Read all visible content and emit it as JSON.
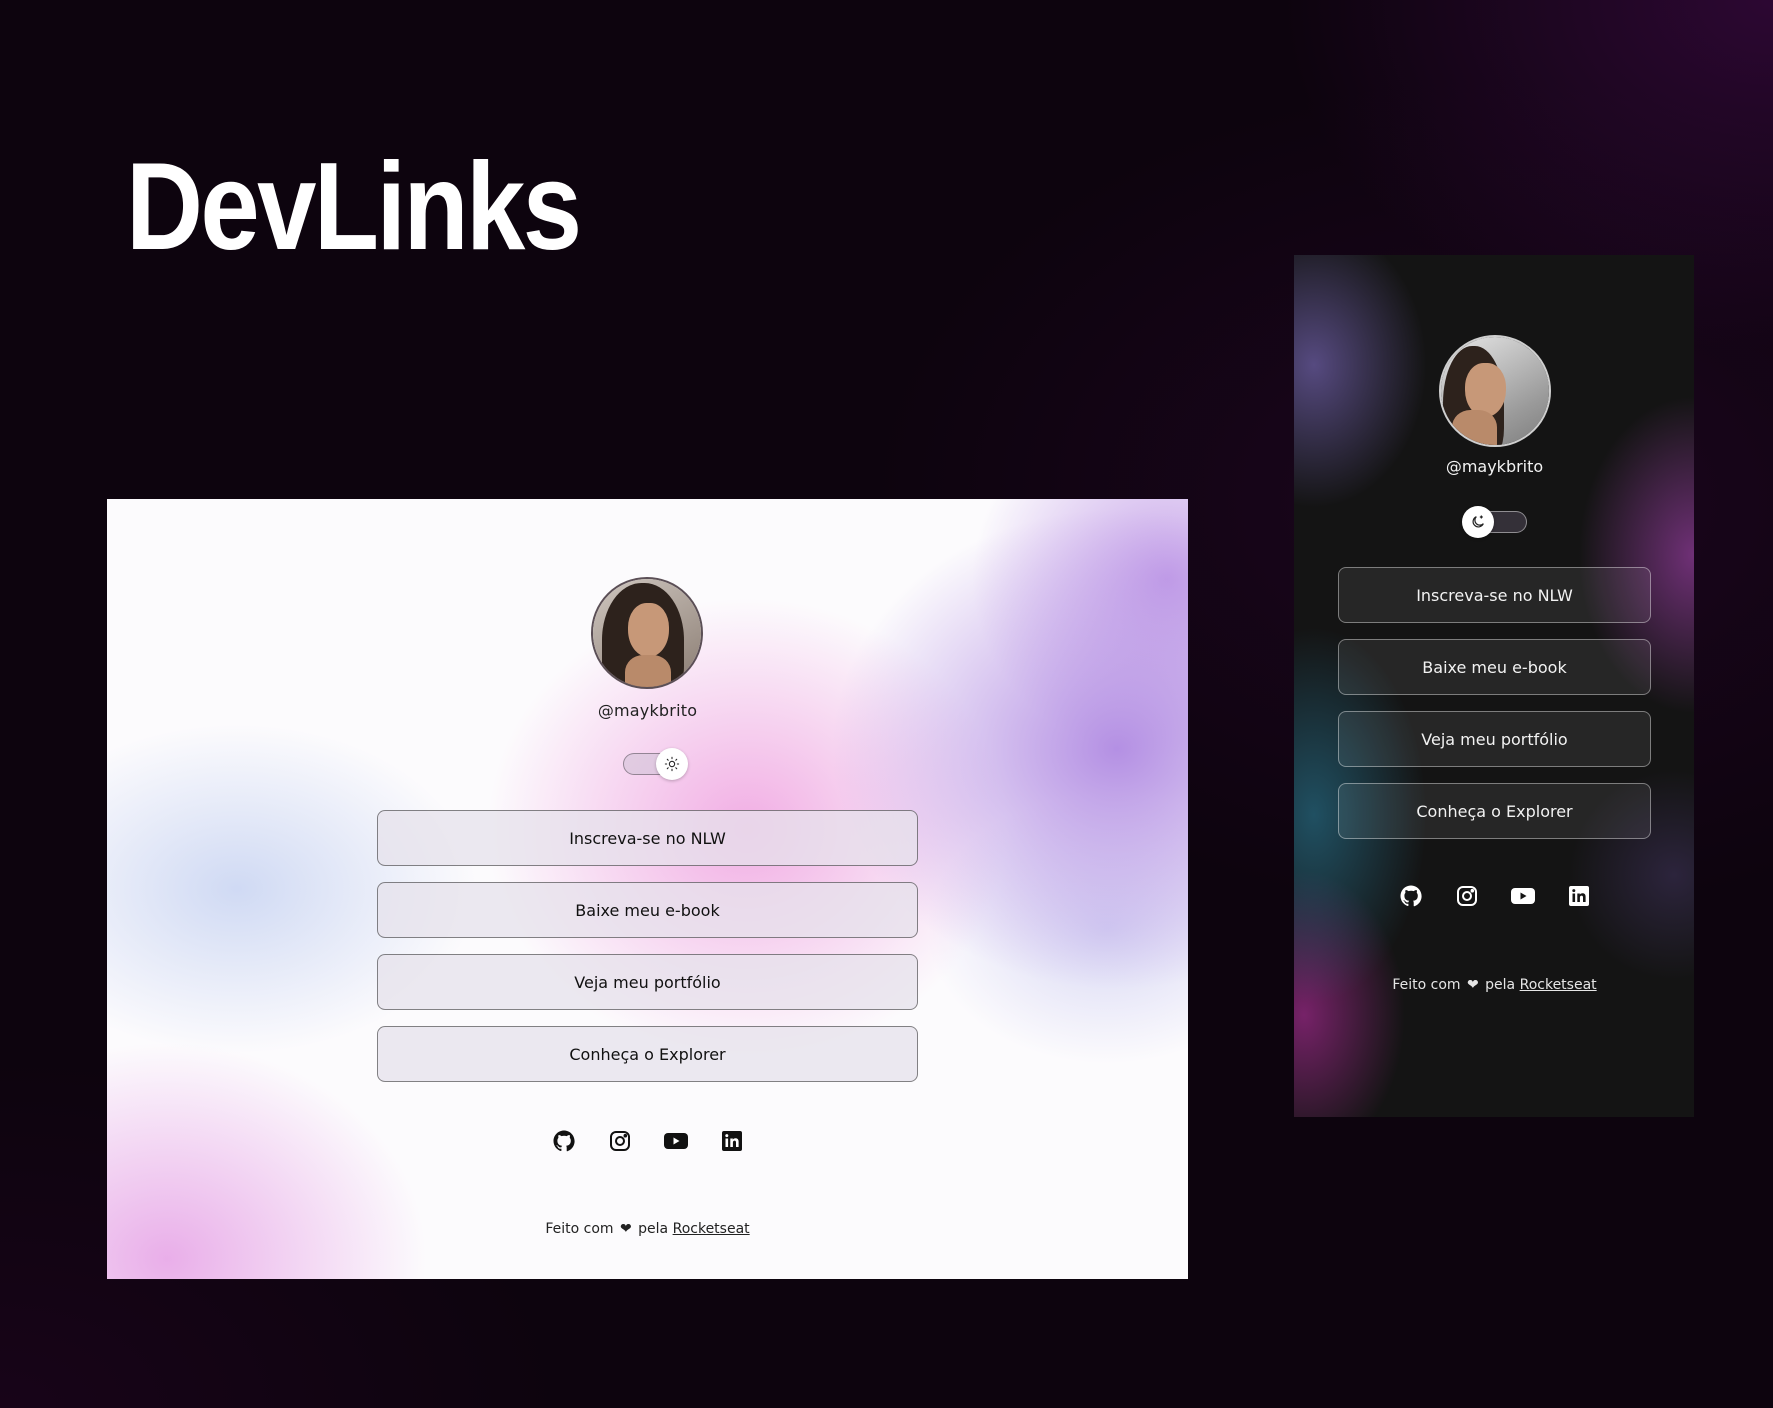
{
  "title": "DevLinks",
  "profile": {
    "handle": "@maykbrito"
  },
  "links": [
    {
      "label": "Inscreva-se no NLW"
    },
    {
      "label": "Baixe meu e-book"
    },
    {
      "label": "Veja meu portfólio"
    },
    {
      "label": "Conheça o Explorer"
    }
  ],
  "social": [
    "github-icon",
    "instagram-icon",
    "youtube-icon",
    "linkedin-icon"
  ],
  "footer": {
    "prefix": "Feito com",
    "heart": "❤",
    "middle": "pela",
    "link": "Rocketseat"
  },
  "themes": {
    "light_toggle_icon": "sun-icon",
    "dark_toggle_icon": "moon-icon"
  },
  "colors": {
    "background": "#0d040e",
    "dark_card": "#141414",
    "light_card": "#fcfbfd"
  }
}
